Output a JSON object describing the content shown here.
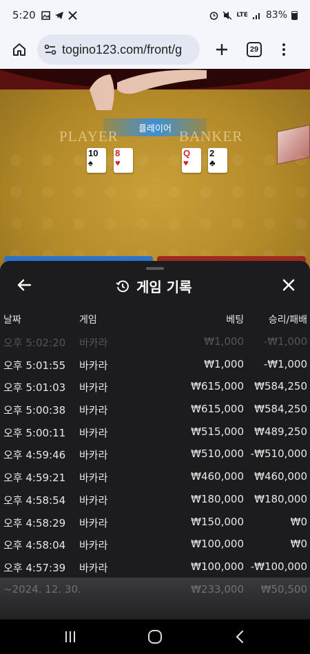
{
  "status_bar": {
    "time": "5:20",
    "network": "LTE",
    "battery": "83%"
  },
  "browser": {
    "url": "togino123.com/front/g",
    "tab_count": "29"
  },
  "game": {
    "result_banner": "플레이어",
    "player_label": "PLAYER",
    "banker_label": "BANKER",
    "player_cards": [
      {
        "rank": "10",
        "suit": "♠",
        "color": "black"
      },
      {
        "rank": "8",
        "suit": "♥",
        "color": "red"
      }
    ],
    "banker_cards": [
      {
        "rank": "Q",
        "suit": "♥",
        "color": "red"
      },
      {
        "rank": "2",
        "suit": "♣",
        "color": "black"
      }
    ]
  },
  "sheet": {
    "title": "게임 기록",
    "columns": {
      "date": "날짜",
      "game": "게임",
      "bet": "베팅",
      "result": "승리/패배"
    },
    "rows": [
      {
        "date": "오후 5:02:20",
        "game": "바카라",
        "bet": "₩1,000",
        "result": "-₩1,000"
      },
      {
        "date": "오후 5:01:55",
        "game": "바카라",
        "bet": "₩1,000",
        "result": "-₩1,000"
      },
      {
        "date": "오후 5:01:03",
        "game": "바카라",
        "bet": "₩615,000",
        "result": "₩584,250"
      },
      {
        "date": "오후 5:00:38",
        "game": "바카라",
        "bet": "₩615,000",
        "result": "₩584,250"
      },
      {
        "date": "오후 5:00:11",
        "game": "바카라",
        "bet": "₩515,000",
        "result": "₩489,250"
      },
      {
        "date": "오후 4:59:46",
        "game": "바카라",
        "bet": "₩510,000",
        "result": "-₩510,000"
      },
      {
        "date": "오후 4:59:21",
        "game": "바카라",
        "bet": "₩460,000",
        "result": "₩460,000"
      },
      {
        "date": "오후 4:58:54",
        "game": "바카라",
        "bet": "₩180,000",
        "result": "₩180,000"
      },
      {
        "date": "오후 4:58:29",
        "game": "바카라",
        "bet": "₩150,000",
        "result": "₩0"
      },
      {
        "date": "오후 4:58:04",
        "game": "바카라",
        "bet": "₩100,000",
        "result": "₩0"
      },
      {
        "date": "오후 4:57:39",
        "game": "바카라",
        "bet": "₩100,000",
        "result": "-₩100,000"
      }
    ],
    "summary": {
      "date": "~2024. 12. 30.",
      "bet": "₩233,000",
      "result": "₩50,500"
    }
  }
}
